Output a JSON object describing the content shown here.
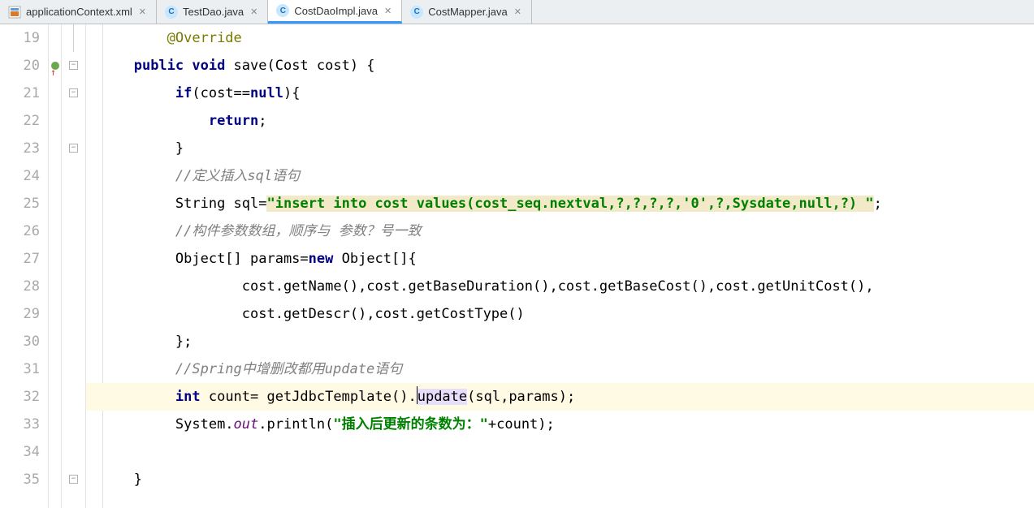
{
  "tabs": [
    {
      "label": "applicationContext.xml",
      "kind": "xml",
      "active": false,
      "closable": true
    },
    {
      "label": "TestDao.java",
      "kind": "java",
      "active": false,
      "closable": true
    },
    {
      "label": "CostDaoImpl.java",
      "kind": "java",
      "active": true,
      "closable": true
    },
    {
      "label": "CostMapper.java",
      "kind": "java",
      "active": false,
      "closable": true
    }
  ],
  "gutter": {
    "start": 19,
    "end": 35,
    "marker_line": 20,
    "folds": [
      20,
      21,
      23,
      35
    ]
  },
  "caret_line": 32,
  "code": {
    "l19": "@Override",
    "l20_kw": "public void",
    "l20_sig": " save(Cost cost) {",
    "l21_kw": "if",
    "l21_rest": "(cost==",
    "l21_null": "null",
    "l21_tail": "){",
    "l22_kw": "return",
    "l22_tail": ";",
    "l23": "}",
    "l24": "//定义插入sql语句",
    "l25_a": "String sql=",
    "l25_str": "\"insert into cost values(cost_seq.nextval,?,?,?,?,'0',?,Sysdate,null,?) \"",
    "l25_tail": ";",
    "l26": "//构件参数数组，顺序与 参数？号一致",
    "l27_a": "Object[] params=",
    "l27_new": "new",
    "l27_b": " Object[]{",
    "l28": "cost.getName(),cost.getBaseDuration(),cost.getBaseCost(),cost.getUnitCost(),",
    "l29": "cost.getDescr(),cost.getCostType()",
    "l30": "};",
    "l31": "//Spring中增删改都用update语句",
    "l32_kw": "int",
    "l32_a": " count= getJdbcTemplate().",
    "l32_m": "update",
    "l32_b": "(sql,params);",
    "l33_a": "System.",
    "l33_out": "out",
    "l33_b": ".println(",
    "l33_str": "\"插入后更新的条数为：\"",
    "l33_c": "+count);",
    "l35": "}"
  }
}
